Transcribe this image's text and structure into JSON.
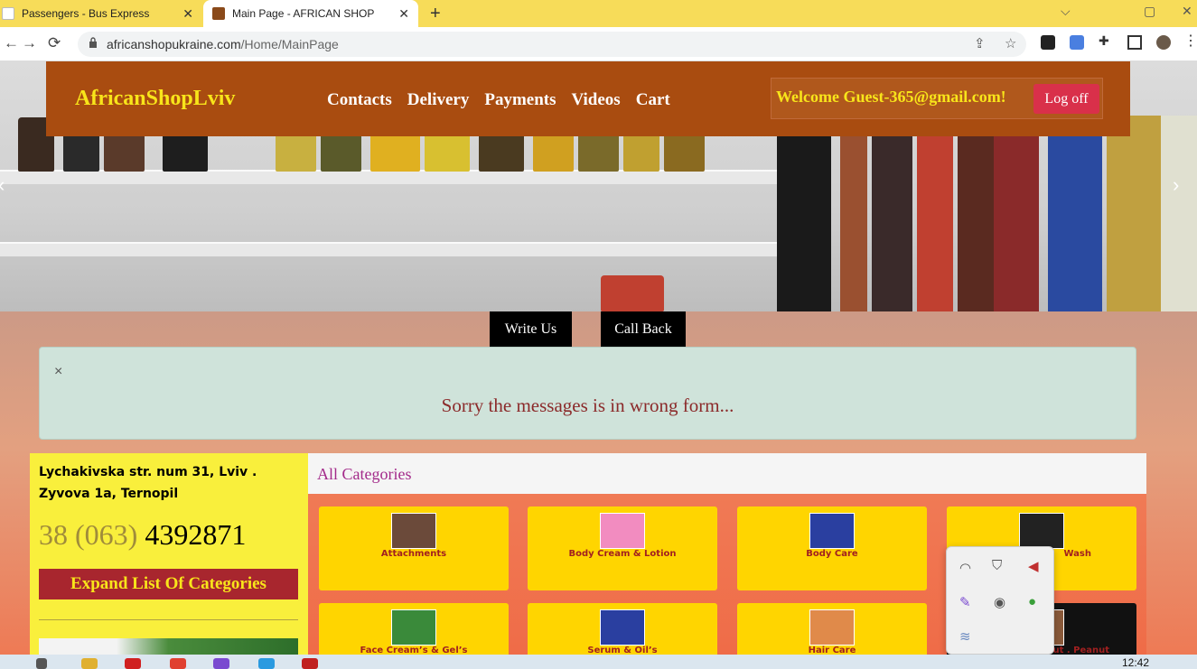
{
  "browser": {
    "tabs": [
      {
        "title": "Passengers - Bus Express"
      },
      {
        "title": "Main Page - AFRICAN SHOP"
      }
    ],
    "new_tab": "+",
    "url_domain": "africanshopukraine.com",
    "url_path": "/Home/MainPage",
    "window_controls": {
      "minimize": "⌵",
      "maximize": "▢",
      "close": "✕"
    }
  },
  "site": {
    "brand": "AfricanShopLviv",
    "menu": [
      "Contacts",
      "Delivery",
      "Payments",
      "Videos",
      "Cart"
    ],
    "welcome": "Welcome Guest-365@gmail.com!",
    "logoff": "Log off",
    "write_us": "Write Us",
    "call_back": "Call Back",
    "alert_close": "×",
    "alert_message": "Sorry the messages is in wrong form...",
    "address": "Lychakivska str. num 31, Lviv . Zyvova 1a, Ternopil",
    "phone_prefix": "38 (063)",
    "phone_number": "4392871",
    "expand_button": "Expand List Of Categories",
    "categories_title": "All Categories",
    "categories": [
      {
        "label": "Attachments",
        "color": "#6b4a3a"
      },
      {
        "label": "Body Cream & Lotion",
        "color": "#f28cc0"
      },
      {
        "label": "Body Care",
        "color": "#2a3fa0"
      },
      {
        "label": "Wash",
        "color": "#222222"
      },
      {
        "label": "Face Cream’s & Gel’s",
        "color": "#3a8a3a"
      },
      {
        "label": "Serum & Oil’s",
        "color": "#2a3fa0"
      },
      {
        "label": "Hair Care",
        "color": "#e08a4a"
      },
      {
        "label": "ut . Peanut",
        "color": "#8a5a3a"
      }
    ]
  },
  "taskbar": {
    "clock": "12:42"
  },
  "colors": {
    "chrome_yellow": "#f7dc59",
    "nav_brown": "#a94c10",
    "brand_yellow": "#f8e51a",
    "logoff_red": "#d9304a",
    "alert_bg": "#cfe3da",
    "alert_text": "#8b2a2a",
    "side_yellow": "#f9ef3c",
    "expand_red": "#a8262e",
    "card_yellow": "#ffd500",
    "category_title": "#a32a8a"
  }
}
